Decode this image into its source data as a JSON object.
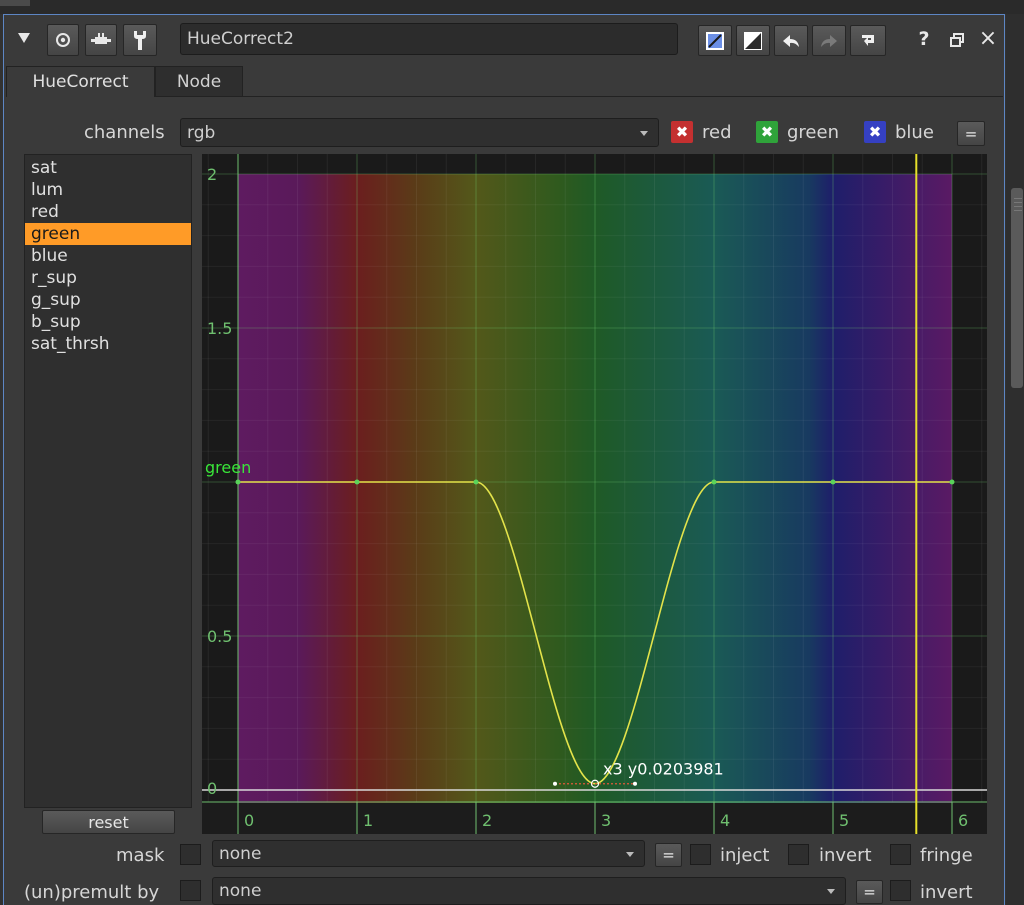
{
  "toolbar": {
    "collapse_icon": "collapse-triangle-icon",
    "left_icons": [
      "viewer-icon",
      "plug-icon",
      "wrench-icon"
    ],
    "node_name": "HueCorrect2",
    "right_icons": [
      "node-color-icon",
      "color-swatch-icon",
      "undo-icon",
      "redo-icon",
      "revert-icon"
    ],
    "help_label": "?",
    "float_icon": "float-window-icon",
    "close_label": "×"
  },
  "tabs": [
    "HueCorrect",
    "Node"
  ],
  "channels": {
    "label": "channels",
    "value": "rgb",
    "toggles": [
      {
        "label": "red",
        "color": "#c43030"
      },
      {
        "label": "green",
        "color": "#2fa33a"
      },
      {
        "label": "blue",
        "color": "#3540c2"
      }
    ],
    "link_label": "="
  },
  "curves": [
    "sat",
    "lum",
    "red",
    "green",
    "blue",
    "r_sup",
    "g_sup",
    "b_sup",
    "sat_thrsh"
  ],
  "selected_curve": "green",
  "reset_label": "reset",
  "chart_data": {
    "type": "line",
    "series": [
      {
        "name": "green",
        "color": "#e3e34a",
        "x": [
          0,
          1,
          2,
          3,
          4,
          5,
          6
        ],
        "y": [
          1,
          1,
          1,
          0.0203981,
          1,
          1,
          1
        ]
      }
    ],
    "xlim": [
      -0.3,
      6.3
    ],
    "ylim": [
      -0.05,
      2.1
    ],
    "x_ticks": [
      "0",
      "1",
      "2",
      "3",
      "4",
      "5",
      "6"
    ],
    "y_ticks": [
      "0",
      "0.5",
      "1.5",
      "2"
    ],
    "selected_point_label": "x3 y0.0203981",
    "current_frame_x": 5.7,
    "grid": true
  },
  "mask": {
    "label": "mask",
    "value": "none",
    "link_label": "=",
    "inject": "inject",
    "invert": "invert",
    "fringe": "fringe"
  },
  "premult": {
    "label": "(un)premult by",
    "value": "none",
    "link_label": "=",
    "invert": "invert"
  }
}
